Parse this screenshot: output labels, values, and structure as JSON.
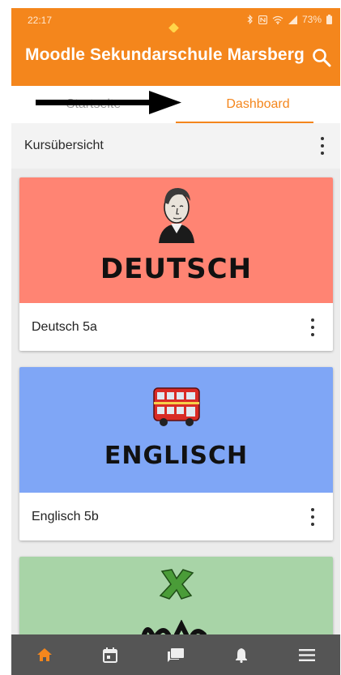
{
  "status_bar": {
    "time": "22:17",
    "battery": "73%"
  },
  "app_bar": {
    "title": "Moodle Sekundarschule Marsberg",
    "search_icon": "search-icon"
  },
  "tabs": [
    {
      "label": "Startseite",
      "active": false
    },
    {
      "label": "Dashboard",
      "active": true
    }
  ],
  "section": {
    "label": "Kursübersicht",
    "menu_icon": "more-vert-icon"
  },
  "courses": [
    {
      "banner_text": "DEUTSCH",
      "name": "Deutsch 5a",
      "banner_color": "#ff8473"
    },
    {
      "banner_text": "ENGLISCH",
      "name": "Englisch 5b",
      "banner_color": "#7fa6f6"
    },
    {
      "banner_text": "",
      "name": "",
      "banner_color": "#a8d4a7"
    }
  ],
  "bottom_nav": [
    {
      "icon": "home-icon",
      "active": true
    },
    {
      "icon": "calendar-icon",
      "active": false
    },
    {
      "icon": "messages-icon",
      "active": false
    },
    {
      "icon": "bell-icon",
      "active": false
    },
    {
      "icon": "menu-icon",
      "active": false
    }
  ],
  "colors": {
    "brand": "#f4861c",
    "nav_bg": "#555555",
    "nav_icon": "#eeeeee"
  }
}
